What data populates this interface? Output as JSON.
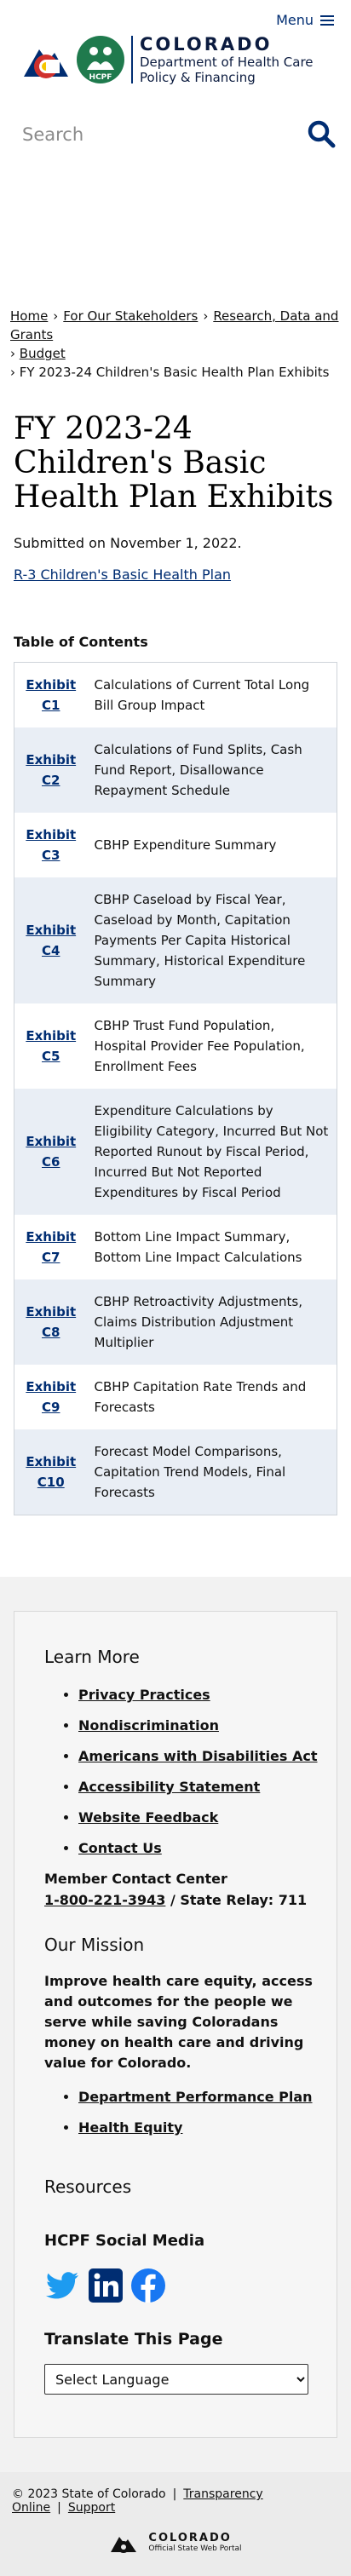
{
  "header": {
    "menu_label": "Menu",
    "org_name": "COLORADO",
    "org_sub_line1": "Department of Health Care",
    "org_sub_line2": "Policy & Financing",
    "hcpf_mark": "HCPF"
  },
  "search": {
    "placeholder": "Search"
  },
  "breadcrumb": {
    "items": [
      "Home",
      "For Our Stakeholders",
      "Research, Data and Grants",
      "Budget"
    ],
    "current": "FY 2023-24 Children's Basic Health Plan Exhibits",
    "separator": "›"
  },
  "page": {
    "title": "FY 2023-24 Children's Basic Health Plan Exhibits",
    "submitted": "Submitted on November 1, 2022.",
    "doc_link": "R-3 Children's Basic Health Plan"
  },
  "toc": {
    "heading": "Table of Contents",
    "rows": [
      {
        "exhibit": "Exhibit C1",
        "desc": "Calculations of Current Total Long Bill Group Impact"
      },
      {
        "exhibit": "Exhibit C2",
        "desc": "Calculations of Fund Splits, Cash Fund Report, Disallowance Repayment Schedule"
      },
      {
        "exhibit": "Exhibit C3",
        "desc": "CBHP Expenditure Summary"
      },
      {
        "exhibit": "Exhibit C4",
        "desc": "CBHP Caseload by Fiscal Year, Caseload by Month, Capitation Payments Per Capita Historical Summary, Historical Expenditure Summary"
      },
      {
        "exhibit": "Exhibit C5",
        "desc": "CBHP Trust Fund Population, Hospital Provider Fee Population, Enrollment Fees"
      },
      {
        "exhibit": "Exhibit C6",
        "desc": "Expenditure Calculations by Eligibility Category, Incurred But Not Reported Runout by Fiscal Period, Incurred But Not Reported Expenditures by Fiscal Period"
      },
      {
        "exhibit": "Exhibit C7",
        "desc": "Bottom Line Impact Summary, Bottom Line Impact Calculations"
      },
      {
        "exhibit": "Exhibit C8",
        "desc": "CBHP Retroactivity Adjustments, Claims Distribution Adjustment Multiplier"
      },
      {
        "exhibit": "Exhibit C9",
        "desc": "CBHP Capitation Rate Trends and Forecasts"
      },
      {
        "exhibit": "Exhibit C10",
        "desc": "Forecast Model Comparisons, Capitation Trend Models, Final Forecasts"
      }
    ]
  },
  "footer": {
    "learn_more": "Learn More",
    "learn_links": [
      "Privacy Practices",
      "Nondiscrimination",
      "Americans with Disabilities Act",
      "Accessibility Statement",
      "Website Feedback",
      "Contact Us"
    ],
    "contact_label": "Member Contact Center",
    "contact_phone": "1-800-221-3943",
    "contact_relay": " / State Relay: 711",
    "mission_head": "Our Mission",
    "mission_text": "Improve health care equity, access and outcomes for the people we serve while saving Coloradans money on health care and driving value for Colorado.",
    "mission_links": [
      "Department Performance Plan",
      "Health Equity"
    ],
    "resources_head": "Resources",
    "social_head": "HCPF Social Media",
    "social_icons": [
      "twitter-icon",
      "linkedin-icon",
      "facebook-icon"
    ],
    "translate_head": "Translate This Page",
    "select_language": "Select Language"
  },
  "bottom": {
    "copyright": "© 2023 State of Colorado",
    "links": [
      "Transparency Online",
      "Support"
    ],
    "portal_name": "COLORADO",
    "portal_sub": "Official State Web Portal"
  },
  "colors": {
    "brand_blue": "#002d72",
    "hcpf_green": "#1f7a4d",
    "co_red": "#d0312d",
    "co_yellow": "#f7c600",
    "table_alt_row": "#e9eef5"
  }
}
